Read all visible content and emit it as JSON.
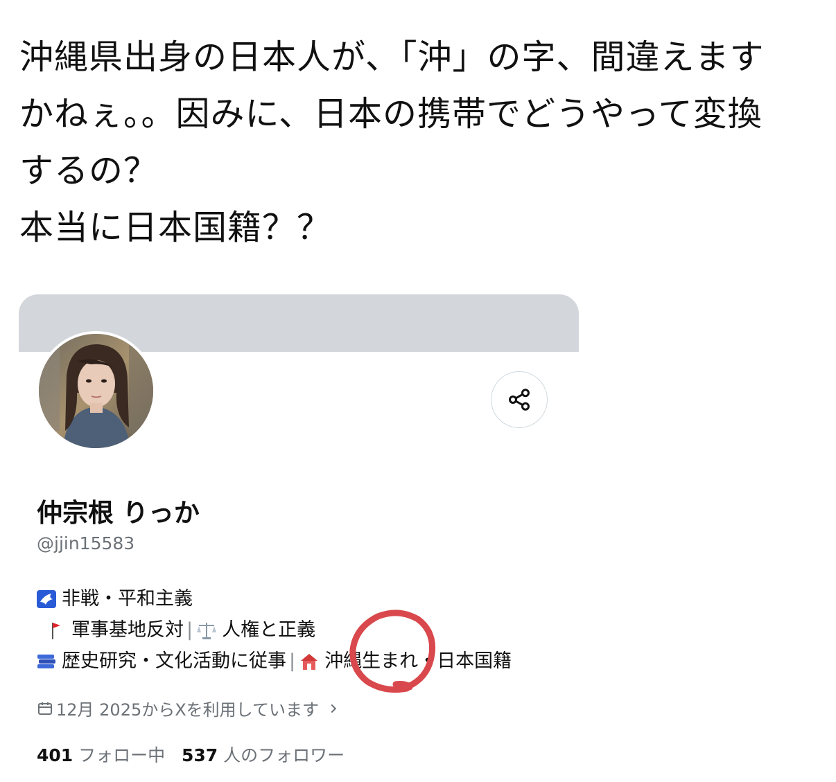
{
  "post": {
    "lines": [
      "沖縄県出身の日本人が、「沖」の字、間違えます",
      "かねぇ。。因みに、日本の携帯でどうやって変換",
      "するの？",
      "本当に日本国籍？？"
    ]
  },
  "profile": {
    "display_name": "仲宗根 りっか",
    "handle": "@jjin15583",
    "bio": {
      "line1": "非戦・平和主義",
      "line2a": "軍事基地反対",
      "line2b": "人権と正義",
      "line3a": "歴史研究・文化活動に従事",
      "line3b": "沖縄生まれ・日本国籍",
      "separator": "|"
    },
    "joined": "12月 2025からXを利用しています",
    "following_count": "401",
    "following_label": "フォロー中",
    "followers_count": "537",
    "followers_label": "人のフォロワー"
  },
  "icons": {
    "share": "share-icon",
    "calendar": "calendar-icon",
    "chevron": "chevron-right-icon"
  },
  "colors": {
    "banner": "#d3d7db",
    "muted": "#6b7177",
    "annotation": "#d9484c"
  }
}
